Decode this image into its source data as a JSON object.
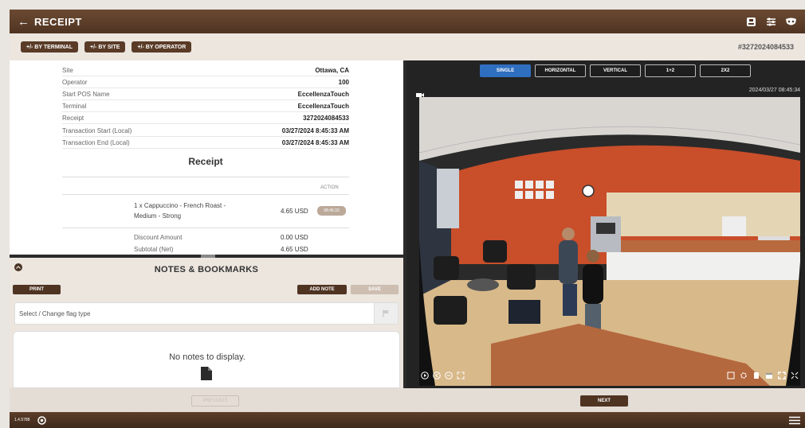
{
  "header": {
    "back_glyph": "←",
    "title": "RECEIPT",
    "icons": [
      "export-icon",
      "settings-sliders-icon",
      "privacy-mask-icon"
    ]
  },
  "filters": {
    "by_terminal": "+/- BY TERMINAL",
    "by_site": "+/- BY SITE",
    "by_operator": "+/- BY OPERATOR",
    "receipt_id": "#3272024084533"
  },
  "details": [
    {
      "key": "Site",
      "value": "Ottawa, CA"
    },
    {
      "key": "Operator",
      "value": "100"
    },
    {
      "key": "Start POS Name",
      "value": "EccellenzaTouch"
    },
    {
      "key": "Terminal",
      "value": "EccellenzaTouch"
    },
    {
      "key": "Receipt",
      "value": "3272024084533"
    },
    {
      "key": "Transaction Start (Local)",
      "value": "03/27/2024 8:45:33 AM"
    },
    {
      "key": "Transaction End (Local)",
      "value": "03/27/2024 8:45:33 AM"
    }
  ],
  "receipt": {
    "title": "Receipt",
    "action_header": "ACTION",
    "item": {
      "line1": "1 x Cappuccino - French Roast -",
      "line2": "Medium - Strong",
      "price": "4.65 USD",
      "time_button": "08:45:33"
    },
    "summary": [
      {
        "key": "Discount Amount",
        "value": "0.00 USD"
      },
      {
        "key": "Subtotal (Net)",
        "value": "4.65 USD"
      }
    ]
  },
  "notes": {
    "title": "NOTES & BOOKMARKS",
    "print": "PRINT",
    "add_note": "ADD NOTE",
    "save": "SAVE",
    "flag_placeholder": "Select / Change flag type",
    "empty": "No notes to display."
  },
  "video": {
    "views": [
      "SINGLE",
      "HORIZONTAL",
      "VERTICAL",
      "1+2",
      "2X2"
    ],
    "active_view": "SINGLE",
    "timestamp": "2024/03/27 08:45:34"
  },
  "nav": {
    "previous": "PREVIOUS",
    "next": "NEXT"
  },
  "footer": {
    "version": "1.4.5788"
  },
  "colors": {
    "brand": "#4f3422",
    "active": "#2f6fc0",
    "wall": "#c94e2a"
  }
}
